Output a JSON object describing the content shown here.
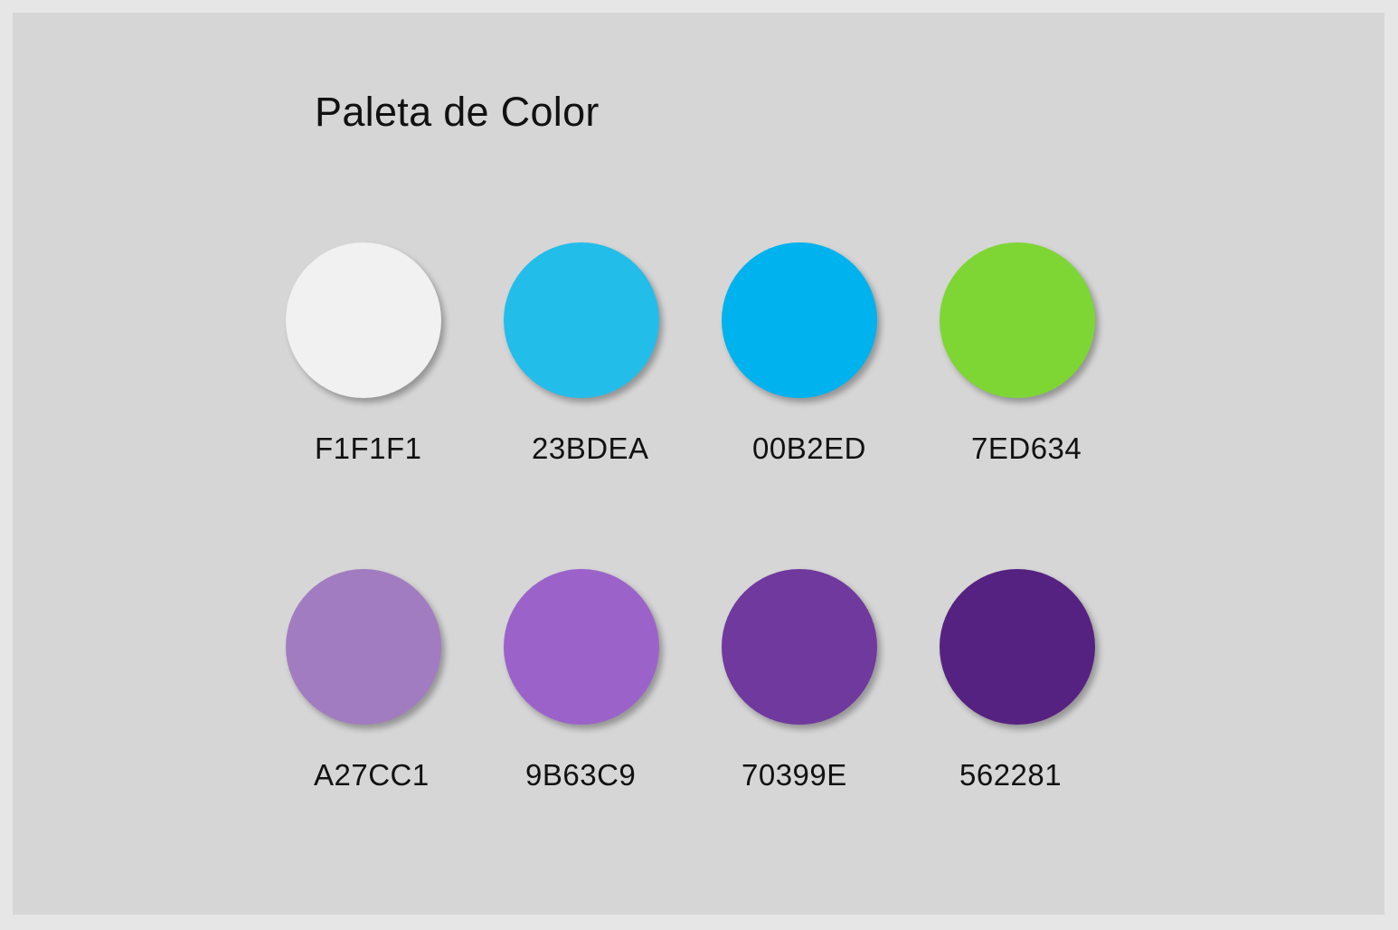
{
  "title": "Paleta de Color",
  "swatches": [
    {
      "hex": "F1F1F1",
      "color": "#F1F1F1"
    },
    {
      "hex": "23BDEA",
      "color": "#23BDEA"
    },
    {
      "hex": "00B2ED",
      "color": "#00B2ED"
    },
    {
      "hex": "7ED634",
      "color": "#7ED634"
    },
    {
      "hex": "A27CC1",
      "color": "#A27CC1"
    },
    {
      "hex": "9B63C9",
      "color": "#9B63C9"
    },
    {
      "hex": "70399E",
      "color": "#70399E"
    },
    {
      "hex": "562281",
      "color": "#562281"
    }
  ]
}
